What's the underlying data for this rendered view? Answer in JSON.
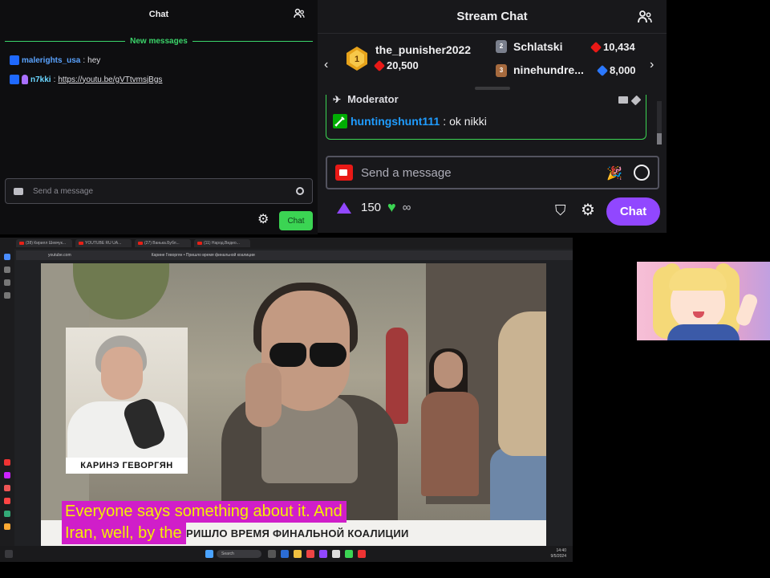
{
  "left_chat": {
    "title": "Chat",
    "new_messages": "New messages",
    "messages": [
      {
        "user": "malerights_usa",
        "text": "hey"
      },
      {
        "user": "n7kki",
        "text": "https://youtu.be/gVTtvmsjBgs"
      }
    ],
    "input_placeholder": "Send a message",
    "chat_button": "Chat",
    "colors": {
      "user1": "#5aa3ff",
      "user2": "#6ad6ff",
      "accent": "#3bd453"
    }
  },
  "stream_chat": {
    "title": "Stream Chat",
    "leaderboard": [
      {
        "rank": "1",
        "name": "the_punisher2022",
        "points": "20,500",
        "gem": "red"
      },
      {
        "rank": "2",
        "name": "Schlatski",
        "points": "10,434",
        "gem": "red"
      },
      {
        "rank": "3",
        "name": "ninehundre...",
        "points": "8,000",
        "gem": "blue"
      }
    ],
    "pinned_header": "Moderator",
    "pinned_message": {
      "user": "huntingshunt111",
      "text": "ok nikki"
    },
    "input_placeholder": "Send a message",
    "channel_points": "150",
    "infinity": "∞",
    "chat_button": "Chat",
    "colors": {
      "accent": "#9147ff",
      "mod": "#00ad03",
      "user": "#1f9cff"
    }
  },
  "browser": {
    "tabs": [
      "(38) Кирилл Шевчук...",
      "YOUTUBE RU UA...",
      "(27) Ванька.Бубл...",
      "(11) Народ.Видео..."
    ],
    "url": "youtube.com",
    "page_title": "Карине Геворгян • Пришло время финальной коалиции",
    "taskbar_search": "Search",
    "clock": "14:40",
    "date": "9/5/2024"
  },
  "video": {
    "pip_name": "КАРИНЭ ГЕВОРГЯН",
    "subtitle_lines": [
      "Everyone says something about it.  And",
      "Iran, well, by the"
    ],
    "lower_third": "ПРИШЛО ВРЕМЯ ФИНАЛЬНОЙ КОАЛИЦИИ",
    "subtitle_color": "#f4f000",
    "subtitle_bg": "#d01ec9"
  }
}
